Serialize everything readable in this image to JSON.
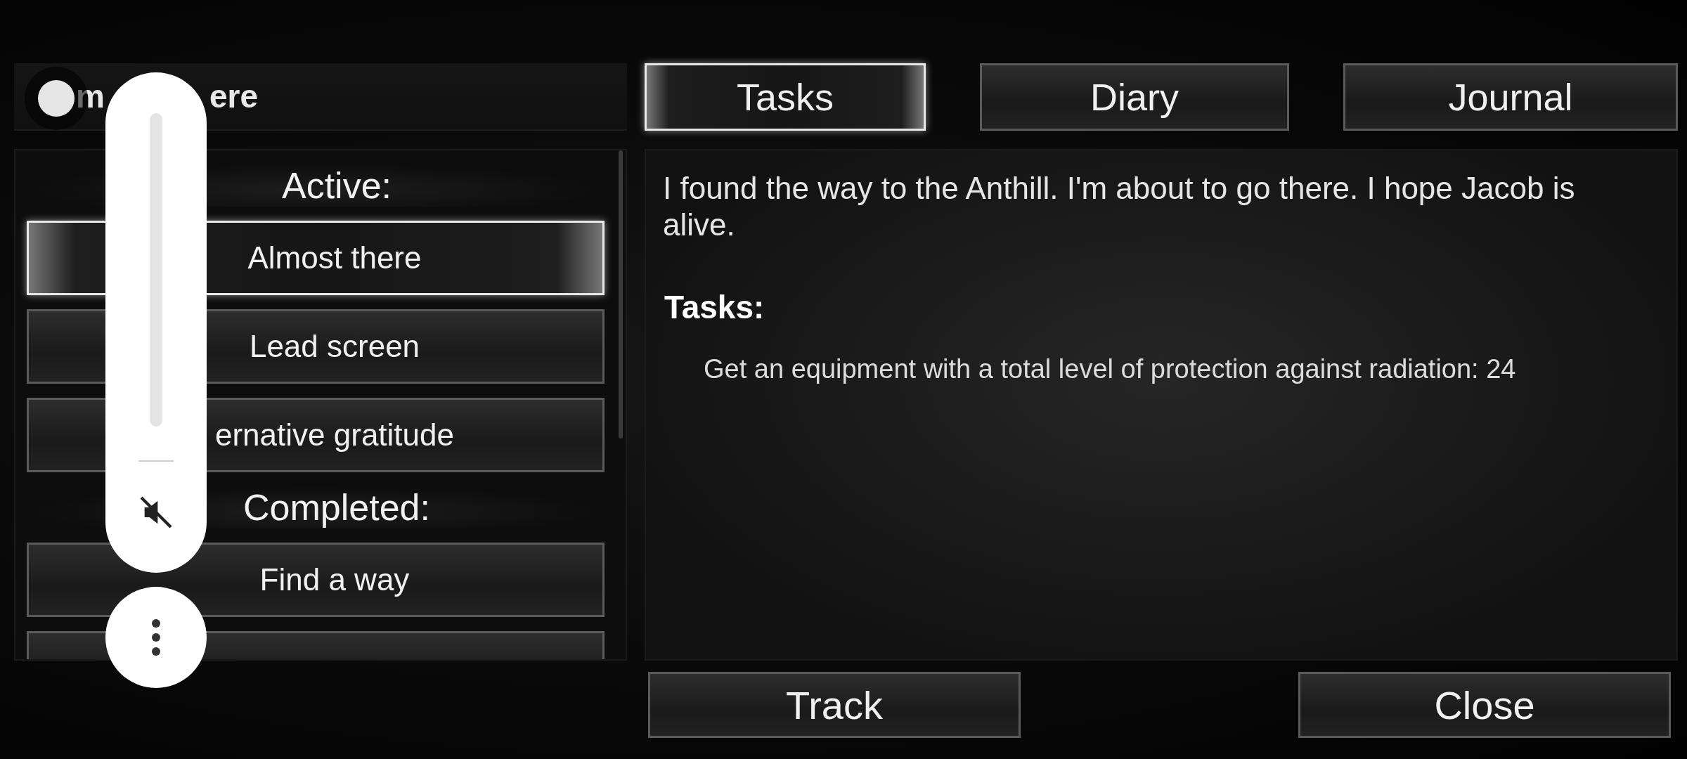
{
  "quest_title": [
    "m",
    "ere"
  ],
  "quest_list": [
    {
      "kind": "header",
      "label": "Active:"
    },
    {
      "kind": "item",
      "label": "Almost there",
      "selected": true
    },
    {
      "kind": "item",
      "label": "Lead screen",
      "selected": false
    },
    {
      "kind": "item",
      "label": "ernative gratitude",
      "selected": false
    },
    {
      "kind": "header",
      "label": "Completed:"
    },
    {
      "kind": "item",
      "label": "Find a way",
      "selected": false
    },
    {
      "kind": "item",
      "selected": false
    }
  ],
  "tabs": [
    {
      "label": "Tasks",
      "selected": true
    },
    {
      "label": "Diary",
      "selected": false
    },
    {
      "label": "Journal",
      "selected": false
    }
  ],
  "description": "I found the way to the Anthill. I'm about to go there. I hope Jacob is alive.",
  "tasks_heading": "Tasks:",
  "tasks": [
    "Get an equipment with a total level of protection against radiation: 24"
  ],
  "buttons": [
    "Track",
    "Close"
  ],
  "volume": {
    "level": 0,
    "muted": true
  }
}
